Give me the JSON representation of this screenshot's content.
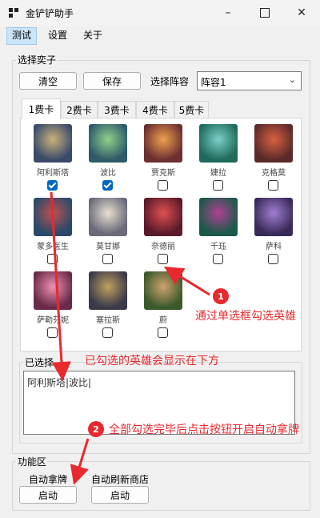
{
  "window": {
    "title": "金铲铲助手",
    "minimize_icon": "minimize-icon",
    "maximize_icon": "maximize-icon",
    "close_icon": "close-icon"
  },
  "menu": [
    "测试",
    "设置",
    "关于"
  ],
  "select_group": {
    "title": "选择奕子",
    "clear_label": "清空",
    "save_label": "保存",
    "lineup_label": "选择阵容",
    "lineup_value": "阵容1"
  },
  "tabs": [
    "1费卡",
    "2费卡",
    "3费卡",
    "4费卡",
    "5费卡"
  ],
  "heroes": [
    {
      "name": "阿利斯塔",
      "checked": true
    },
    {
      "name": "波比",
      "checked": true
    },
    {
      "name": "贾克斯",
      "checked": false
    },
    {
      "name": "婕拉",
      "checked": false
    },
    {
      "name": "克格莫",
      "checked": false
    },
    {
      "name": "蒙多医生",
      "checked": false
    },
    {
      "name": "莫甘娜",
      "checked": false
    },
    {
      "name": "奈德丽",
      "checked": false
    },
    {
      "name": "千珏",
      "checked": false
    },
    {
      "name": "萨科",
      "checked": false
    },
    {
      "name": "萨勒芬妮",
      "checked": false
    },
    {
      "name": "塞拉斯",
      "checked": false
    },
    {
      "name": "蔚",
      "checked": false
    }
  ],
  "selected": {
    "title": "已选择",
    "value": "阿利斯塔|波比|"
  },
  "function_group": {
    "title": "功能区",
    "auto_pick_label": "自动拿牌",
    "auto_refresh_label": "自动刷新商店",
    "start_label_1": "启动",
    "start_label_2": "启动"
  },
  "annotations": {
    "num1": "1",
    "text1": "通过单选框勾选英雄",
    "text_middle": "已勾选的英雄会显示在下方",
    "num2": "2",
    "text2": "全部勾选完毕后点击按钮开启自动拿牌"
  },
  "colors": {
    "accent": "#0067c0",
    "annotation": "#e8292e"
  }
}
